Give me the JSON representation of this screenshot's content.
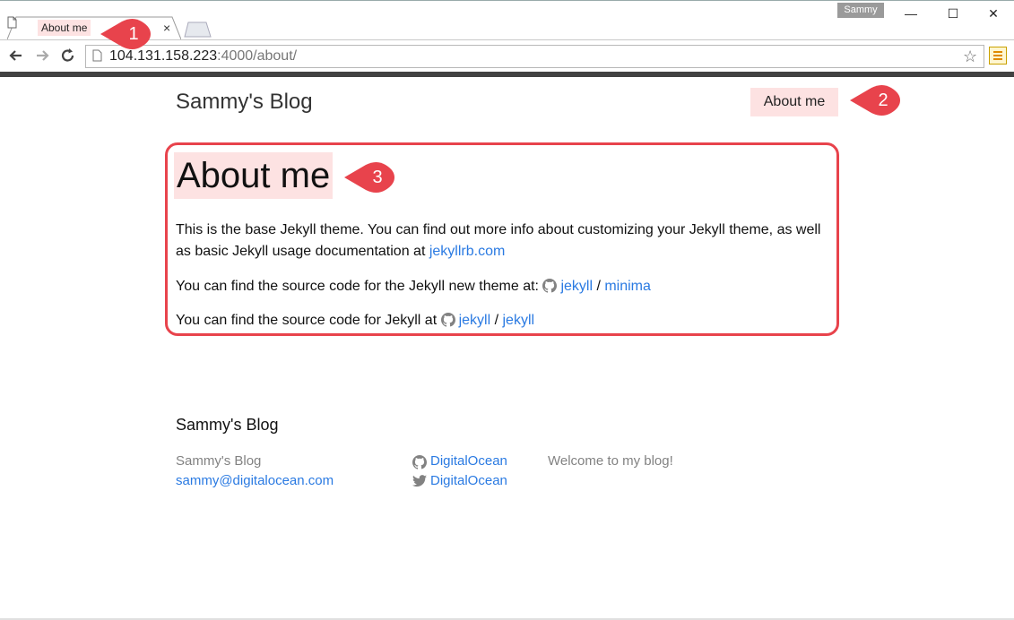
{
  "browser": {
    "tab_title": "About me",
    "tab_close": "×",
    "profile": "Sammy",
    "win_minimize": "—",
    "win_maximize": "☐",
    "win_close": "✕",
    "url_host": "104.131.158.223",
    "url_path": ":4000/about/",
    "star": "☆"
  },
  "site": {
    "title": "Sammy's Blog",
    "nav": [
      "About me"
    ]
  },
  "post": {
    "title": "About me",
    "p1_text": "This is the base Jekyll theme. You can find out more info about customizing your Jekyll theme, as well as basic Jekyll usage documentation at ",
    "p1_link": "jekyllrb.com",
    "p2_text": "You can find the source code for the Jekyll new theme at: ",
    "p2_link_user": "jekyll",
    "p2_sep": " / ",
    "p2_link_repo": "minima",
    "p3_text": "You can find the source code for Jekyll at ",
    "p3_link_user": "jekyll",
    "p3_sep": " / ",
    "p3_link_repo": "jekyll"
  },
  "footer": {
    "heading": "Sammy's Blog",
    "name": "Sammy's Blog",
    "email": "sammy@digitalocean.com",
    "github": "DigitalOcean",
    "twitter": "DigitalOcean",
    "description": "Welcome to my blog!"
  },
  "callouts": [
    "1",
    "2",
    "3"
  ],
  "colors": {
    "highlight": "#fde2e2",
    "callout": "#e8434c",
    "link": "#2a7ae2"
  },
  "icons": [
    "page-icon",
    "back-arrow-icon",
    "forward-arrow-icon",
    "reload-icon",
    "star-icon",
    "chrome-menu-icon",
    "github-icon",
    "twitter-icon"
  ]
}
